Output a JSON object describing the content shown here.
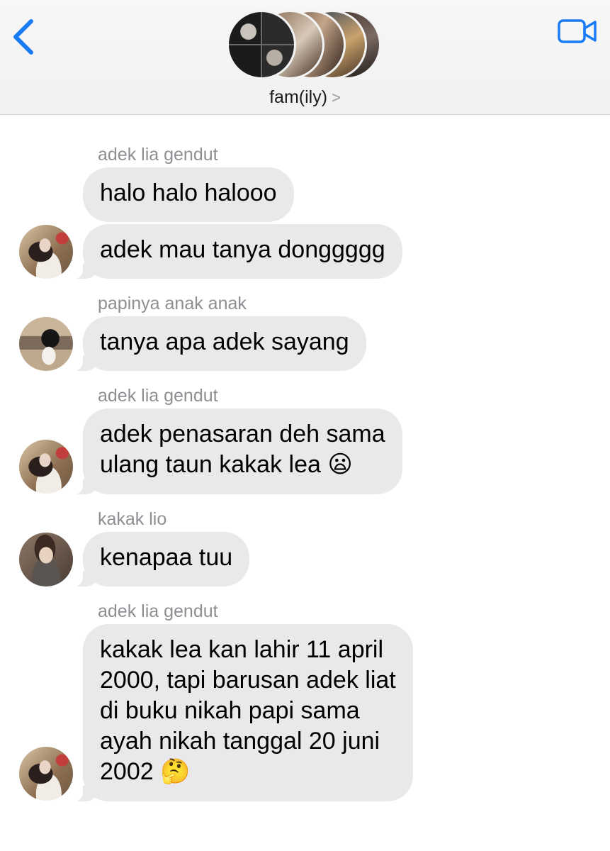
{
  "header": {
    "group_name": "fam(ily)",
    "chevron": ">",
    "back_icon": "chevron-left-icon",
    "video_icon": "video-camera-icon",
    "accent_color": "#1a7cf5"
  },
  "messages": [
    {
      "sender": "adek lia gendut",
      "bubbles": [
        "halo halo halooo",
        "adek mau tanya donggggg"
      ]
    },
    {
      "sender": "papinya anak anak",
      "bubbles": [
        "tanya apa adek sayang"
      ]
    },
    {
      "sender": "adek lia gendut",
      "bubbles": [
        "adek penasaran deh sama\nulang taun kakak lea 😦"
      ]
    },
    {
      "sender": "kakak lio",
      "bubbles": [
        "kenapaa tuu"
      ]
    },
    {
      "sender": "adek lia gendut",
      "bubbles": [
        "kakak lea kan lahir 11 april\n2000, tapi barusan adek liat\ndi buku nikah papi sama\nayah nikah tanggal 20 juni\n2002 🤔"
      ]
    }
  ],
  "colors": {
    "bubble_bg": "#e9e9eb",
    "sender_text": "#8e8e93"
  }
}
